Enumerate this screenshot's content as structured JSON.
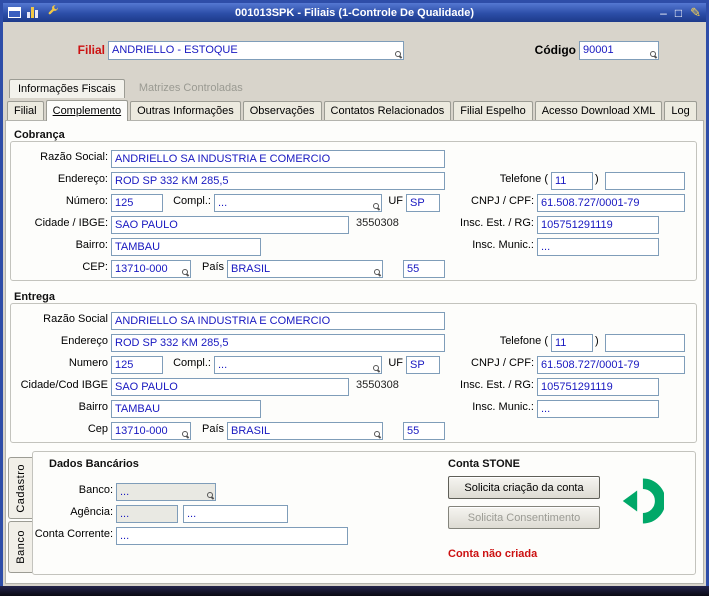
{
  "colors": {
    "titlebar_blue": "#2c4ea8",
    "frame_blue": "#2e4da8",
    "accent_red": "#cc1111",
    "field_text_blue": "#1818c0",
    "stone_green": "#00a868"
  },
  "titlebar": {
    "title": "001013SPK - Filiais (1-Controle De Qualidade)",
    "minimize": "–",
    "maximize": "□",
    "edit": "✎"
  },
  "header": {
    "filial_label": "Filial",
    "filial_value": "ANDRIELLO - ESTOQUE",
    "codigo_label": "Código",
    "codigo_value": "90001"
  },
  "folder_tabs": [
    {
      "label": "Informações Fiscais"
    },
    {
      "label": "Matrizes Controladas"
    }
  ],
  "tabs": [
    {
      "label": "Filial"
    },
    {
      "label": "Complemento"
    },
    {
      "label": "Outras Informações"
    },
    {
      "label": "Observações"
    },
    {
      "label": "Contatos Relacionados"
    },
    {
      "label": "Filial Espelho"
    },
    {
      "label": "Acesso Download XML"
    },
    {
      "label": "Log"
    }
  ],
  "cobranca": {
    "title": "Cobrança",
    "labels": {
      "razao_social": "Razão Social:",
      "endereco": "Endereço:",
      "numero": "Número:",
      "compl": "Compl.:",
      "uf": "UF",
      "cidade": "Cidade / IBGE:",
      "bairro": "Bairro:",
      "cep": "CEP:",
      "pais": "País",
      "telefone_open": "Telefone (",
      "telefone_close": ")",
      "cnpj": "CNPJ / CPF:",
      "insc_est": "Insc. Est. / RG:",
      "insc_mun": "Insc. Munic.:"
    },
    "values": {
      "razao_social": "ANDRIELLO SA INDUSTRIA E COMERCIO",
      "endereco": "ROD SP 332 KM 285,5",
      "ddd": "11",
      "telefone": "",
      "numero": "125",
      "compl": "...",
      "uf": "SP",
      "cnpj": "61.508.727/0001-79",
      "cidade": "SAO PAULO",
      "ibge": "3550308",
      "insc_est": "105751291119",
      "bairro": "TAMBAU",
      "insc_mun": "...",
      "cep": "13710-000",
      "pais": "BRASIL",
      "pais_cod": "55"
    }
  },
  "entrega": {
    "title": "Entrega",
    "labels": {
      "razao_social": "Razão Social",
      "endereco": "Endereço",
      "numero": "Numero",
      "compl": "Compl.:",
      "uf": "UF",
      "cidade": "Cidade/Cod IBGE",
      "bairro": "Bairro",
      "cep": "Cep",
      "pais": "País",
      "telefone_open": "Telefone (",
      "telefone_close": ")",
      "cnpj": "CNPJ / CPF:",
      "insc_est": "Insc. Est. / RG:",
      "insc_mun": "Insc. Munic.:"
    },
    "values": {
      "razao_social": "ANDRIELLO SA INDUSTRIA E COMERCIO",
      "endereco": "ROD SP 332 KM 285,5",
      "ddd": "11",
      "telefone": "",
      "numero": "125",
      "compl": "...",
      "uf": "SP",
      "cnpj": "61.508.727/0001-79",
      "cidade": "SAO PAULO",
      "ibge": "3550308",
      "insc_est": "105751291119",
      "bairro": "TAMBAU",
      "insc_mun": "...",
      "cep": "13710-000",
      "pais": "BRASIL",
      "pais_cod": "55"
    }
  },
  "side_tabs": [
    {
      "label": "Cadastro"
    },
    {
      "label": "Banco"
    }
  ],
  "dados_bancarios": {
    "title": "Dados Bancários",
    "labels": {
      "banco": "Banco:",
      "agencia": "Agência:",
      "conta": "Conta Corrente:"
    },
    "values": {
      "banco": "...",
      "agencia": "...",
      "agencia_conta": "...",
      "conta": "..."
    }
  },
  "conta_stone": {
    "title": "Conta STONE",
    "solicita_criacao": "Solicita criação da conta",
    "solicita_consentimento": "Solicita Consentimento",
    "status": "Conta não criada"
  }
}
